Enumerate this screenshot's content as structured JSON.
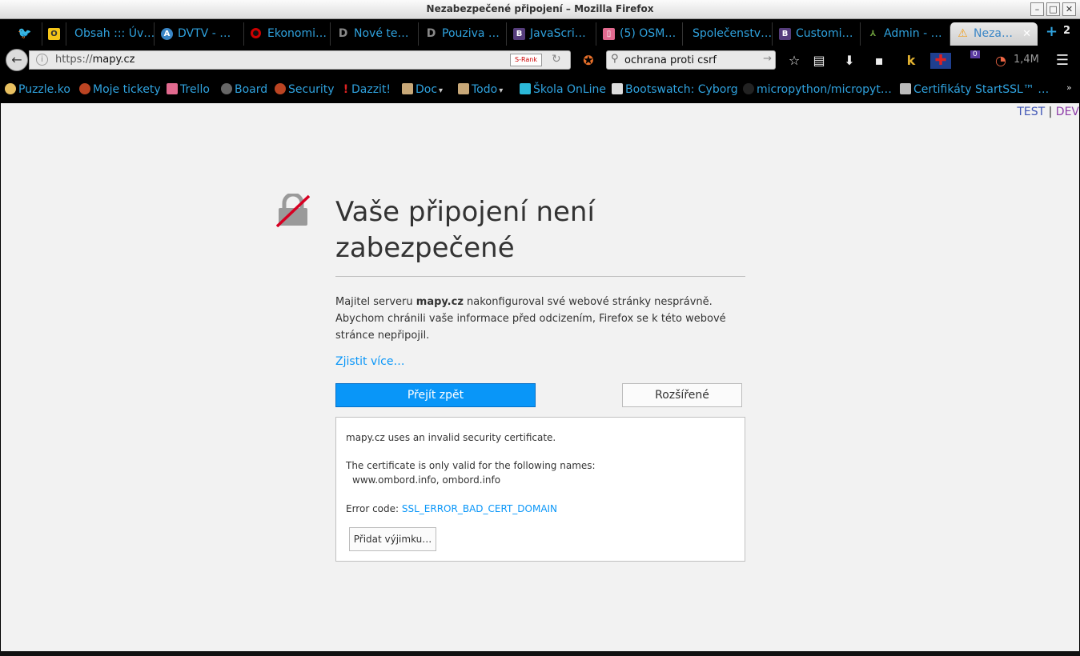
{
  "window": {
    "title": "Nezabezpečené připojení – Mozilla Firefox"
  },
  "tabs": [
    {
      "label": "",
      "icon": "twitter-icon"
    },
    {
      "label": "",
      "icon": "outlook-icon"
    },
    {
      "label": "Obsah ::: Úv…",
      "icon": "page-icon"
    },
    {
      "label": "DVTV - …",
      "icon": "a-icon"
    },
    {
      "label": "Ekonomi…",
      "icon": "opera-icon"
    },
    {
      "label": "Nové te…",
      "icon": "d-icon"
    },
    {
      "label": "Pouziva …",
      "icon": "d-icon"
    },
    {
      "label": "JavaScri…",
      "icon": "bootstrap-icon"
    },
    {
      "label": "(5) OSM…",
      "icon": "trello-icon"
    },
    {
      "label": "Společenstv…",
      "icon": "page-icon"
    },
    {
      "label": "Customi…",
      "icon": "bootstrap-icon"
    },
    {
      "label": "Admin - …",
      "icon": "admin-icon"
    },
    {
      "label": "Neza…",
      "icon": "warning-icon",
      "active": true
    }
  ],
  "tabstrip": {
    "new_tab": "+",
    "counter": "2"
  },
  "nav": {
    "url_prefix": "https://",
    "url_host": "mapy.cz",
    "srank": "S-Rank",
    "search_value": "ochrana proti csrf",
    "download_size": "1,4M",
    "badge": "0"
  },
  "bookmarks": [
    {
      "label": "Puzzle.ko"
    },
    {
      "label": "Moje tickety"
    },
    {
      "label": "Trello"
    },
    {
      "label": "Board"
    },
    {
      "label": "Security"
    },
    {
      "label": "Dazzit!"
    },
    {
      "label": "Doc"
    },
    {
      "label": "Todo"
    },
    {
      "label": "Škola OnLine"
    },
    {
      "label": "Bootswatch: Cyborg"
    },
    {
      "label": "micropython/micropyt…"
    },
    {
      "label": "Certifikáty StartSSL™ …"
    }
  ],
  "page": {
    "env_test": "TEST",
    "env_sep": "|",
    "env_dev": "DEV",
    "heading": "Vaše připojení není zabezpečené",
    "desc_pre": "Majitel serveru ",
    "desc_host": "mapy.cz",
    "desc_post": " nakonfiguroval své webové stránky nesprávně. Abychom chránili vaše informace před odcizením, Firefox se k této webové stránce nepřipojil.",
    "learn_more": "Zjistit více…",
    "go_back": "Přejít zpět",
    "advanced": "Rozšířené",
    "detail_line1": "mapy.cz uses an invalid security certificate.",
    "detail_line2": "The certificate is only valid for the following names:",
    "detail_line3": "www.ombord.info, ombord.info",
    "error_label": "Error code: ",
    "error_code": "SSL_ERROR_BAD_CERT_DOMAIN",
    "add_exception": "Přidat výjimku…"
  },
  "colors": {
    "accent": "#0996f8",
    "link": "#2fa2de"
  }
}
